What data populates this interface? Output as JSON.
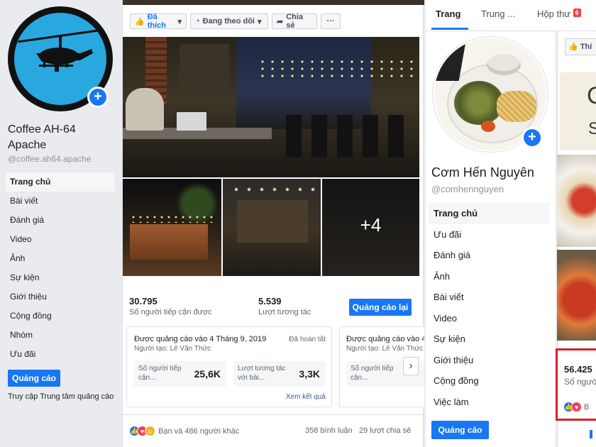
{
  "left_page": {
    "name": "Coffee AH-64 Apache",
    "handle": "@coffee.ah64.apache",
    "nav": [
      "Trang chủ",
      "Bài viết",
      "Đánh giá",
      "Video",
      "Ảnh",
      "Sự kiện",
      "Giới thiệu",
      "Cộng đồng",
      "Nhóm",
      "Ưu đãi"
    ],
    "promote_button": "Quảng cáo",
    "ads_center_link": "Truy cập Trung tâm quảng cáo",
    "actions": {
      "like": "Đã thích",
      "follow": "Đang theo dõi",
      "share": "Chia sẻ",
      "more": "···"
    },
    "photo_more_count": "+4",
    "stats": {
      "reach_value": "30.795",
      "reach_label": "Số người tiếp cận được",
      "engagement_value": "5.539",
      "engagement_label": "Lượt tương tác",
      "boost_again_button": "Quảng cáo lại"
    },
    "promotions": [
      {
        "title": "Được quảng cáo vào 4 Tháng 9, 2019",
        "status": "Đã hoàn tất",
        "creator": "Người tạo: Lê Văn Thức",
        "metric1_label": "Số người tiếp cận...",
        "metric1_value": "25,6K",
        "metric2_label": "Lượt tương tác với bài...",
        "metric2_value": "3,3K",
        "results_link": "Xem kết quả"
      },
      {
        "title": "Được quảng cáo vào 4",
        "creator": "Người tạo: Lê Văn Thức",
        "metric1_label": "Số người tiếp cận..."
      }
    ],
    "reactions_text": "Bạn và 486 người khác",
    "comments_text": "358 bình luận",
    "shares_text": "29 lượt chia sẻ"
  },
  "right_page": {
    "tabs": {
      "home": "Trang",
      "other": "Trung ...",
      "inbox": "Hộp thư",
      "inbox_badge": "6"
    },
    "name": "Cơm Hến Nguyên",
    "handle": "@comhennguyen",
    "nav": [
      "Trang chủ",
      "Ưu đãi",
      "Đánh giá",
      "Ảnh",
      "Bài viết",
      "Video",
      "Sự kiện",
      "Giới thiệu",
      "Cộng đồng",
      "Việc làm"
    ],
    "promote_button": "Quảng cáo",
    "like_button_partial": "Thí",
    "image_text_partial": {
      "c": "C",
      "s": "S"
    },
    "stat_value_partial": "56.425",
    "stat_label_partial": "Số ngườ",
    "reaction_partial": "B"
  },
  "colors": {
    "facebook_blue": "#1877f2",
    "link_blue": "#385898",
    "highlight_red": "#d8202b",
    "apache_cyan": "#29a8e0"
  }
}
